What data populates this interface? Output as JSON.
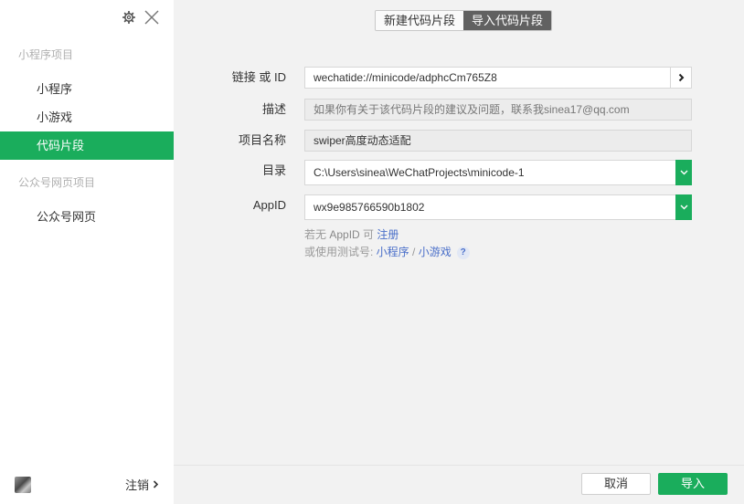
{
  "sidebar": {
    "sections": [
      {
        "title": "小程序项目",
        "items": [
          {
            "label": "小程序"
          },
          {
            "label": "小游戏"
          },
          {
            "label": "代码片段"
          }
        ]
      },
      {
        "title": "公众号网页项目",
        "items": [
          {
            "label": "公众号网页"
          }
        ]
      }
    ],
    "active_item": "代码片段",
    "footer": {
      "logout_label": "注销"
    }
  },
  "tabs": [
    {
      "label": "新建代码片段",
      "active": false
    },
    {
      "label": "导入代码片段",
      "active": true
    }
  ],
  "form": {
    "link": {
      "label": "链接 或 ID",
      "value": "wechatide://minicode/adphcCm765Z8"
    },
    "desc": {
      "label": "描述",
      "value": "如果你有关于该代码片段的建议及问题，联系我sinea17@qq.com"
    },
    "name": {
      "label": "项目名称",
      "value": "swiper高度动态适配"
    },
    "dir": {
      "label": "目录",
      "value": "C:\\Users\\sinea\\WeChatProjects\\minicode-1"
    },
    "appid": {
      "label": "AppID",
      "value": "wx9e985766590b1802"
    }
  },
  "hints": {
    "no_appid_prefix": "若无 ",
    "no_appid_bold": "AppID",
    "no_appid_mid": " 可 ",
    "register_link": "注册",
    "test_prefix": "或使用测试号: ",
    "mini_program_link": "小程序",
    "separator": " / ",
    "mini_game_link": "小游戏",
    "help": "?"
  },
  "buttons": {
    "cancel": "取消",
    "import": "导入"
  },
  "colors": {
    "accent": "#1aad5c",
    "link": "#4a6fc9",
    "active_tab": "#616161"
  }
}
